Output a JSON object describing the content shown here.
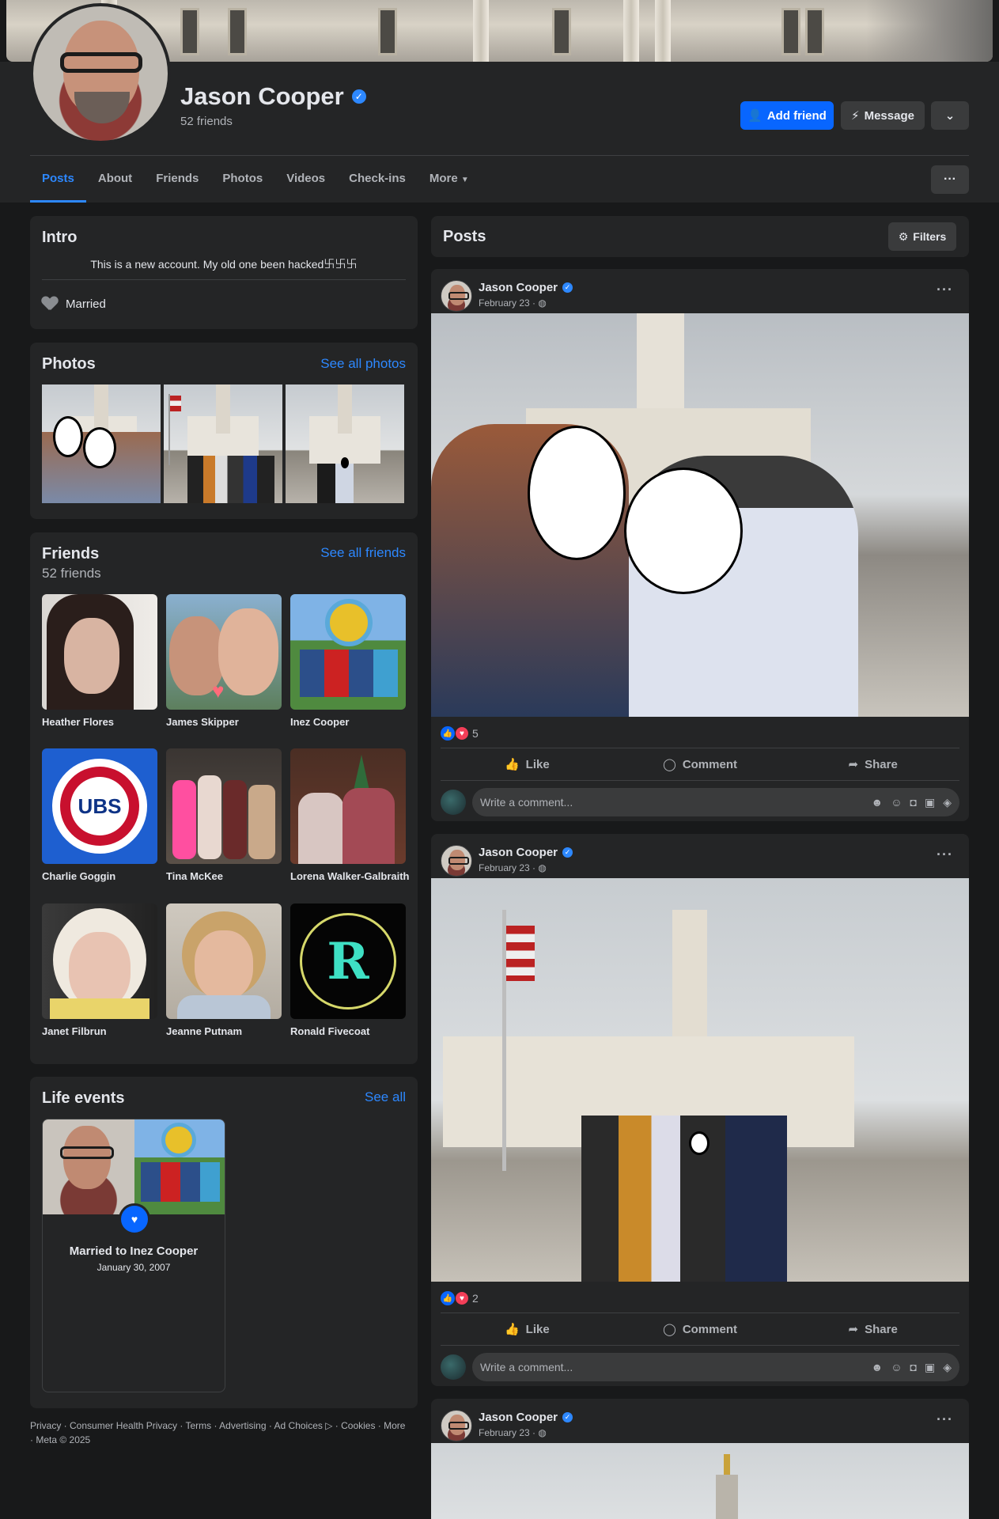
{
  "profile": {
    "name": "Jason Cooper",
    "friends_count": "52 friends",
    "add_friend_label": "Add friend",
    "message_label": "Message"
  },
  "tabs": [
    "Posts",
    "About",
    "Friends",
    "Photos",
    "Videos",
    "Check-ins",
    "More"
  ],
  "intro": {
    "title": "Intro",
    "bio": "This is a new account. My old one been hacked࿕࿕࿕",
    "relationship": "Married"
  },
  "photos": {
    "title": "Photos",
    "see_all": "See all photos"
  },
  "friends": {
    "title": "Friends",
    "count": "52 friends",
    "see_all": "See all friends",
    "items": [
      {
        "name": "Heather Flores"
      },
      {
        "name": "James Skipper"
      },
      {
        "name": "Inez Cooper"
      },
      {
        "name": "Charlie Goggin"
      },
      {
        "name": "Tina McKee"
      },
      {
        "name": "Lorena Walker-Galbraith"
      },
      {
        "name": "Janet Filbrun"
      },
      {
        "name": "Jeanne Putnam"
      },
      {
        "name": "Ronald Fivecoat"
      }
    ]
  },
  "life_events": {
    "title": "Life events",
    "see_all": "See all",
    "event_title": "Married to Inez Cooper",
    "event_date": "January 30, 2007"
  },
  "footer": "Privacy · Consumer Health Privacy · Terms · Advertising · Ad Choices ▷ · Cookies · More · Meta © 2025",
  "posts_header": {
    "title": "Posts",
    "filters_label": "Filters"
  },
  "posts": [
    {
      "author": "Jason Cooper",
      "date": "February 23 · ",
      "reactions": "5",
      "like": "Like",
      "comment": "Comment",
      "share": "Share",
      "comment_placeholder": "Write a comment..."
    },
    {
      "author": "Jason Cooper",
      "date": "February 23 · ",
      "reactions": "2",
      "like": "Like",
      "comment": "Comment",
      "share": "Share",
      "comment_placeholder": "Write a comment..."
    },
    {
      "author": "Jason Cooper",
      "date": "February 23 · "
    }
  ],
  "colors": {
    "accent": "#2d88ff",
    "primary_button": "#0866ff",
    "background": "#18191a",
    "card": "#242526"
  }
}
